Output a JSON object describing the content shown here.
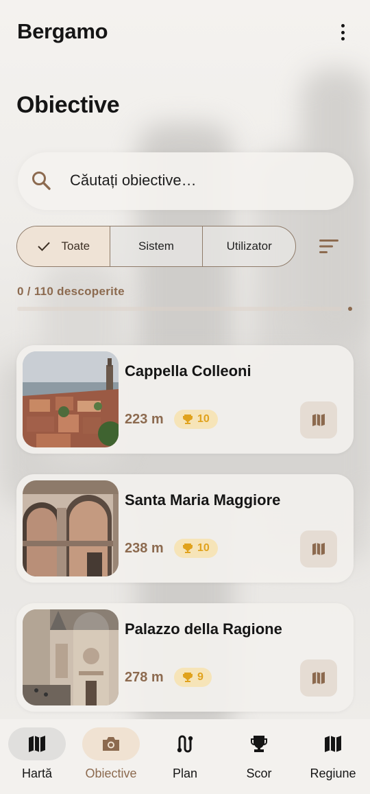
{
  "app_bar": {
    "title": "Bergamo",
    "menu_icon": "more-vert-icon"
  },
  "page": {
    "title": "Obiective"
  },
  "search": {
    "placeholder": "Căutați obiective…",
    "value": "",
    "icon": "search-icon"
  },
  "filters": {
    "segments": [
      {
        "label": "Toate",
        "selected": true,
        "icon": "check-icon"
      },
      {
        "label": "Sistem",
        "selected": false
      },
      {
        "label": "Utilizator",
        "selected": false
      }
    ],
    "sort_icon": "sort-icon"
  },
  "progress": {
    "text": "0 / 110 descoperite",
    "discovered": 0,
    "total": 110,
    "fraction": 0
  },
  "landmarks": [
    {
      "name": "Cappella Colleoni",
      "distance": "223 m",
      "points": "10"
    },
    {
      "name": "Santa Maria Maggiore",
      "distance": "238 m",
      "points": "10"
    },
    {
      "name": "Palazzo della Ragione",
      "distance": "278 m",
      "points": "9"
    }
  ],
  "bottom_nav": [
    {
      "label": "Hartă",
      "icon": "map-icon",
      "selected": false
    },
    {
      "label": "Obiective",
      "icon": "camera-icon",
      "selected": true
    },
    {
      "label": "Plan",
      "icon": "route-icon",
      "selected": false
    },
    {
      "label": "Scor",
      "icon": "trophy-icon",
      "selected": false
    },
    {
      "label": "Regiune",
      "icon": "region-map-icon",
      "selected": false
    }
  ],
  "colors": {
    "accent": "#8c6a4f",
    "points_text": "#e0a21d",
    "points_bg": "#f6e4b8",
    "selected_segment": "#efe3d6"
  }
}
